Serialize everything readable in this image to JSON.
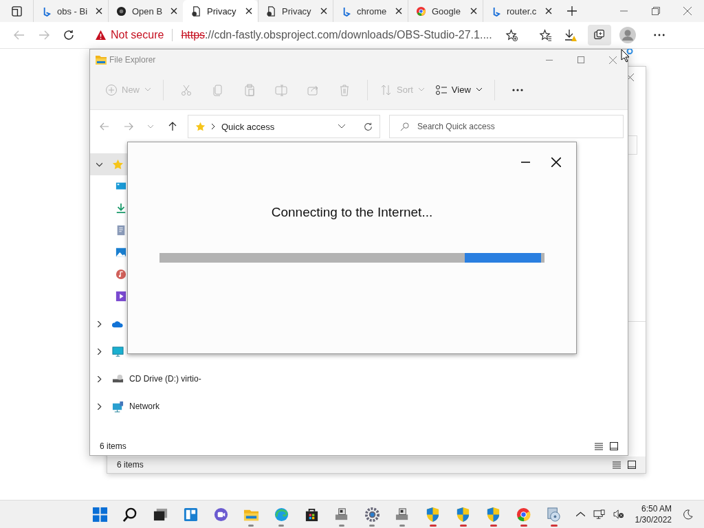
{
  "browser": {
    "tabs": [
      {
        "title": "obs - Bi",
        "selected": false
      },
      {
        "title": "Open B",
        "selected": false
      },
      {
        "title": "Privacy",
        "selected": true
      },
      {
        "title": "Privacy",
        "selected": false
      },
      {
        "title": "chrome",
        "selected": false
      },
      {
        "title": "Google",
        "selected": false
      },
      {
        "title": "router.c",
        "selected": false
      }
    ],
    "address": {
      "security": "Not secure",
      "scheme": "https",
      "url": "://cdn-fastly.obsproject.com/downloads/OBS-Studio-27.1...."
    },
    "download_warning": true,
    "collections_active": true
  },
  "back_window": {
    "status": "6 items"
  },
  "explorer": {
    "title": "File Explorer",
    "toolbar": [
      {
        "kind": "labeled",
        "label": "New",
        "disabled": true
      },
      {
        "kind": "icon",
        "disabled": true
      },
      {
        "kind": "icon",
        "disabled": true
      },
      {
        "kind": "icon",
        "disabled": true
      },
      {
        "kind": "icon",
        "disabled": true
      },
      {
        "kind": "icon",
        "disabled": true
      },
      {
        "kind": "icon",
        "disabled": true
      },
      {
        "kind": "labeled",
        "label": "Sort",
        "disabled": true
      },
      {
        "kind": "labeled",
        "label": "View",
        "disabled": false
      },
      {
        "kind": "icon",
        "disabled": false
      }
    ],
    "nav": {
      "back_disabled": true,
      "forward_disabled": true
    },
    "address": "Quick access",
    "search": {
      "placeholder": "Search Quick access"
    },
    "tree": [
      {
        "selected": true,
        "expanded": true,
        "children": [
          {
            "selected": false
          },
          {
            "selected": false
          },
          {
            "selected": false
          },
          {
            "selected": false
          },
          {
            "selected": false
          },
          {
            "selected": false
          }
        ]
      },
      {
        "selected": false,
        "expanded": false
      },
      {
        "selected": false,
        "expanded": false
      },
      {
        "label": "CD Drive (D:) virtio-",
        "selected": false,
        "expanded": false
      },
      {
        "label": "Network",
        "selected": false,
        "expanded": false
      }
    ],
    "status": "6 items"
  },
  "dialog": {
    "message": "Connecting to the Internet...",
    "progress": {
      "level": 0.2
    }
  },
  "taskbar": {
    "apps": [
      {
        "running": false
      },
      {
        "running": false
      },
      {
        "running": false
      },
      {
        "running": false
      },
      {
        "running": false
      },
      {
        "running": true,
        "needs_attention": false
      },
      {
        "running": true,
        "needs_attention": false
      },
      {
        "running": false
      },
      {
        "running": true,
        "needs_attention": false
      },
      {
        "running": true,
        "needs_attention": false
      },
      {
        "running": true,
        "needs_attention": false
      },
      {
        "running": true,
        "needs_attention": true
      },
      {
        "running": true,
        "needs_attention": true
      },
      {
        "running": true,
        "needs_attention": true
      },
      {
        "running": true,
        "needs_attention": true
      },
      {
        "running": true,
        "needs_attention": true
      }
    ],
    "clock": {
      "time": "6:50 AM",
      "date": "1/30/2022"
    }
  }
}
